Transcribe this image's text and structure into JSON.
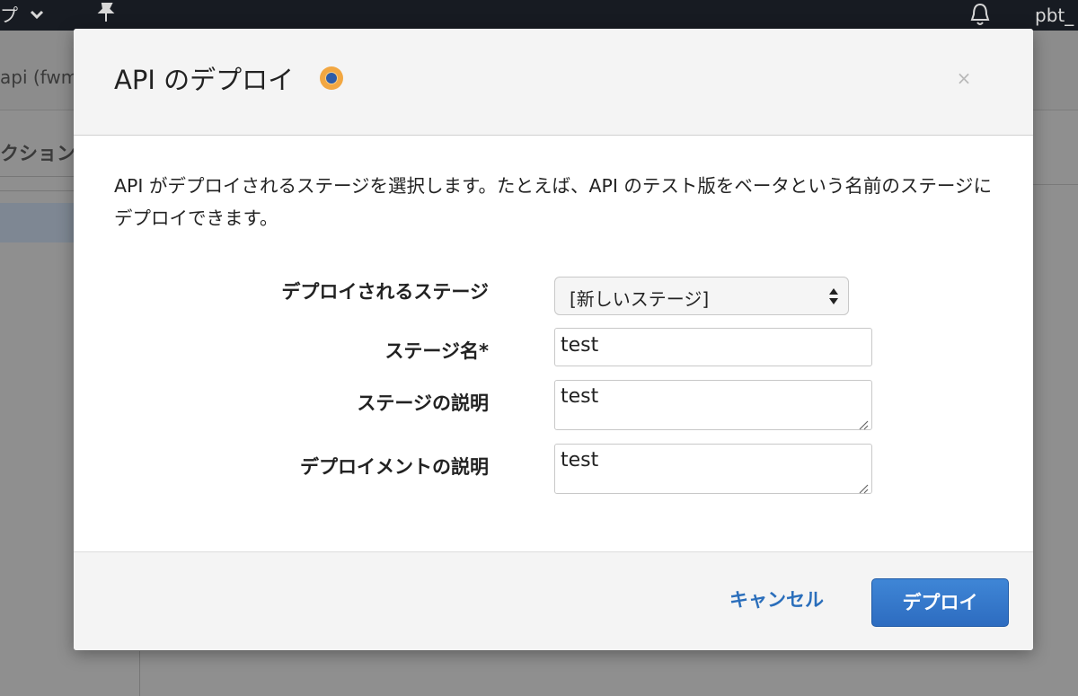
{
  "background": {
    "topbar": {
      "partial_left_glyph": "プ",
      "user_partial": "pbt_"
    },
    "api_title_partial": "api (fwm",
    "actions_partial": "クション"
  },
  "modal": {
    "title": "API のデプロイ",
    "close_label": "×",
    "description": "API がデプロイされるステージを選択します。たとえば、API のテスト版をベータという名前のステージにデプロイできます。",
    "fields": {
      "stage_label": "デプロイされるステージ",
      "stage_value": "[新しいステージ]",
      "stage_name_label": "ステージ名*",
      "stage_name_value": "test",
      "stage_desc_label": "ステージの説明",
      "stage_desc_value": "test",
      "deploy_desc_label": "デプロイメントの説明",
      "deploy_desc_value": "test"
    },
    "footer": {
      "cancel_label": "キャンセル",
      "deploy_label": "デプロイ"
    }
  },
  "colors": {
    "primary": "#2d6cc0",
    "link": "#2a6ebb",
    "info_icon": "#f2a742"
  }
}
